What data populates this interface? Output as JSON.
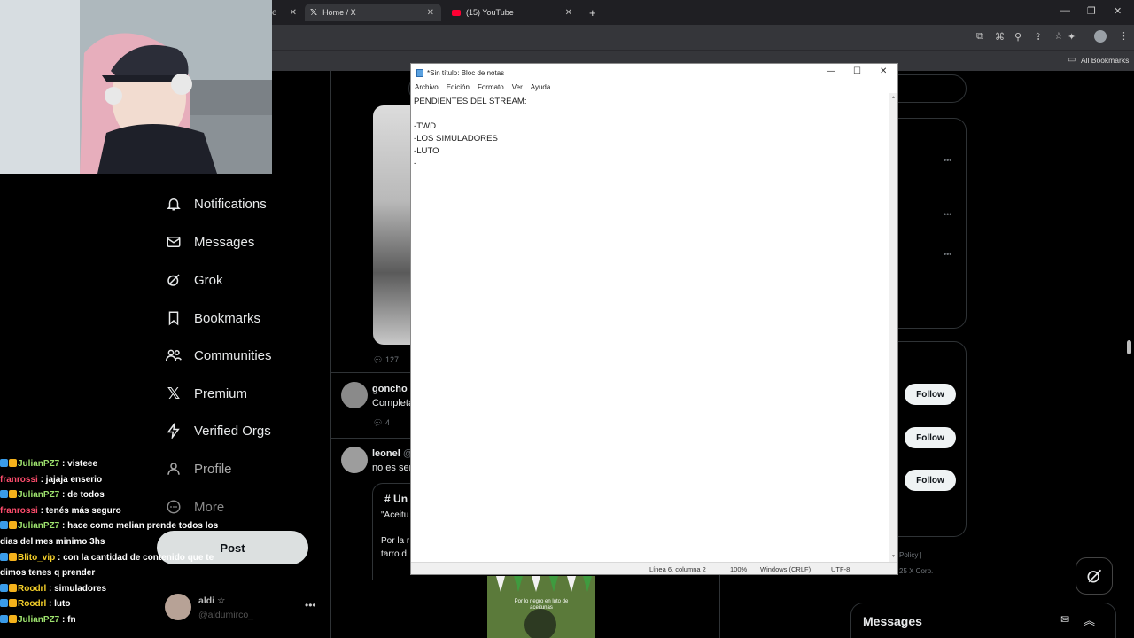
{
  "browser": {
    "tabs": [
      {
        "title": "Home / X",
        "icon": "x-logo-icon"
      },
      {
        "title": "(15) YouTube",
        "icon": "youtube-icon"
      }
    ],
    "new_tab": "+",
    "bookmarks_label": "All Bookmarks"
  },
  "sidebar": {
    "items": [
      {
        "label": "Notifications",
        "icon": "bell-icon"
      },
      {
        "label": "Messages",
        "icon": "envelope-icon"
      },
      {
        "label": "Grok",
        "icon": "grok-icon"
      },
      {
        "label": "Bookmarks",
        "icon": "bookmark-icon"
      },
      {
        "label": "Communities",
        "icon": "people-icon"
      },
      {
        "label": "Premium",
        "icon": "x-logo-icon"
      },
      {
        "label": "Verified Orgs",
        "icon": "lightning-icon"
      },
      {
        "label": "Profile",
        "icon": "person-icon"
      },
      {
        "label": "More",
        "icon": "more-circle-icon"
      }
    ],
    "post_label": "Post",
    "account": {
      "name": "aldi ☆",
      "handle": "@aldumirco_"
    }
  },
  "chat": [
    {
      "user": "JulianPZ7",
      "color": "green",
      "badges": 2,
      "text": ": visteee"
    },
    {
      "user": "franrossi",
      "color": "red",
      "badges": 0,
      "text": ": jajaja enserio"
    },
    {
      "user": "JulianPZ7",
      "color": "green",
      "badges": 2,
      "text": ": de todos"
    },
    {
      "user": "franrossi",
      "color": "red",
      "badges": 0,
      "text": ": tenés más seguro"
    },
    {
      "user": "JulianPZ7",
      "color": "green",
      "badges": 2,
      "text": ": hace como melian prende todos los dias del mes minimo 3hs"
    },
    {
      "user": "Blito_vip",
      "color": "yellow",
      "badges": 2,
      "text": ": con la cantidad de contenido que te dimos tenes q prender"
    },
    {
      "user": "Roodrl",
      "color": "yellow",
      "badges": 2,
      "text": ": simuladores"
    },
    {
      "user": "Roodrl",
      "color": "yellow",
      "badges": 2,
      "text": ": luto"
    },
    {
      "user": "JulianPZ7",
      "color": "green",
      "badges": 2,
      "text": ": fn"
    }
  ],
  "feed": {
    "reply_count_1": "127",
    "post2": {
      "name": "goncho",
      "text": "Completa",
      "replies": "4"
    },
    "post3": {
      "name": "leonel",
      "handle": "@",
      "text": "no es ser"
    },
    "quote": {
      "hashtag": "#",
      "title": "Un",
      "line1": "\"Aceitu",
      "line2": "Por la r",
      "line3": "tarro d"
    },
    "video_caption": "Por lo negro en luto de aceitunas"
  },
  "right": {
    "follow_label": "Follow",
    "footer1": "Policy |",
    "footer2": "25 X Corp."
  },
  "notepad": {
    "title": "*Sin título: Bloc de notas",
    "menu": [
      "Archivo",
      "Edición",
      "Formato",
      "Ver",
      "Ayuda"
    ],
    "content": "PENDIENTES DEL STREAM:\n\n-TWD\n-LOS SIMULADORES\n-LUTO\n-",
    "status": {
      "position": "Línea 6, columna 2",
      "zoom": "100%",
      "eol": "Windows (CRLF)",
      "encoding": "UTF-8"
    }
  },
  "messages_bar": {
    "title": "Messages"
  }
}
